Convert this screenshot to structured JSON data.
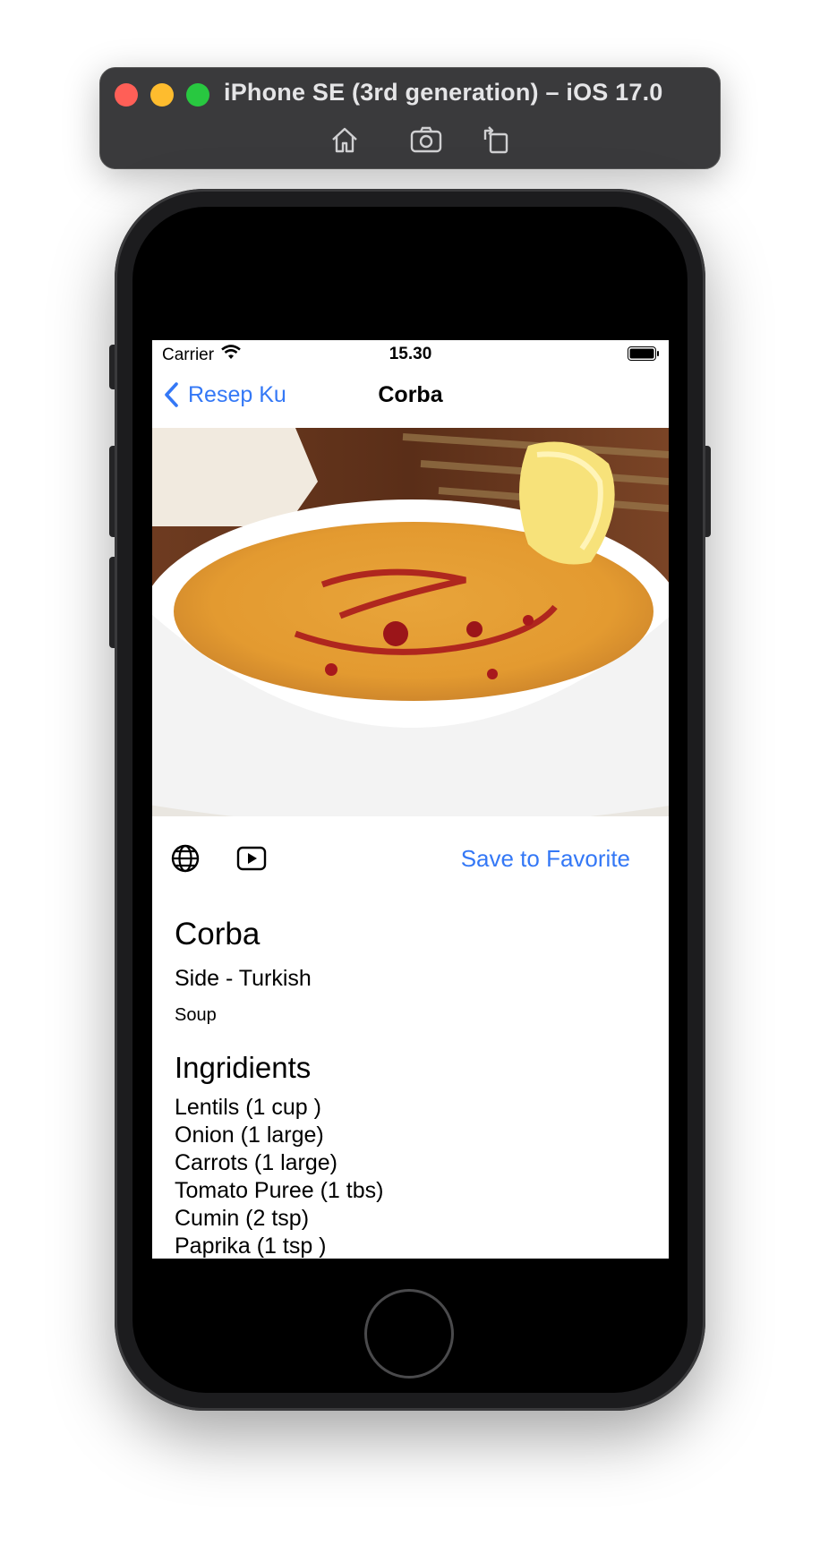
{
  "simulator": {
    "title": "iPhone SE (3rd generation) – iOS 17.0",
    "tools": [
      "home-icon",
      "screenshot-icon",
      "rotate-icon"
    ]
  },
  "status_bar": {
    "carrier": "Carrier",
    "time": "15.30"
  },
  "nav": {
    "back_label": "Resep Ku",
    "title": "Corba"
  },
  "actions": {
    "save_label": "Save to Favorite"
  },
  "meal": {
    "name": "Corba",
    "category_area": "Side - Turkish",
    "tag": "Soup",
    "ingredients_heading": "Ingridients",
    "ingredients": [
      "Lentils (1 cup )",
      "Onion (1 large)",
      "Carrots (1 large)",
      "Tomato Puree (1 tbs)",
      "Cumin (2 tsp)",
      "Paprika (1 tsp )"
    ]
  },
  "colors": {
    "accent": "#3478f6",
    "sim_bar": "#3a3a3c"
  }
}
